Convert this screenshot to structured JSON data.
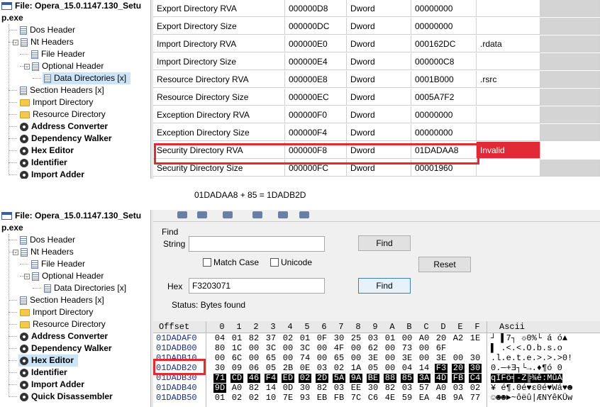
{
  "note": "01DADAA8 + 85 = 1DADB2D",
  "top_tree": [
    {
      "label": "File: Opera_15.0.1147.130_Setu",
      "icon": "window-icon",
      "bold": true,
      "indent": 0
    },
    {
      "label": "p.exe",
      "icon": "",
      "bold": true,
      "indent": 0
    },
    {
      "label": "Dos Header",
      "icon": "page-icon",
      "bold": false,
      "indent": 1
    },
    {
      "label": "Nt Headers",
      "icon": "page-icon",
      "bold": false,
      "indent": 1,
      "expander": "-"
    },
    {
      "label": "File Header",
      "icon": "page-icon",
      "bold": false,
      "indent": 2
    },
    {
      "label": "Optional Header",
      "icon": "page-icon",
      "bold": false,
      "indent": 2,
      "expander": "-"
    },
    {
      "label": "Data Directories [x]",
      "icon": "page-icon",
      "bold": false,
      "indent": 3,
      "selected": true
    },
    {
      "label": "Section Headers [x]",
      "icon": "page-icon",
      "bold": false,
      "indent": 1
    },
    {
      "label": "Import Directory",
      "icon": "folder-icon",
      "bold": false,
      "indent": 1
    },
    {
      "label": "Resource Directory",
      "icon": "folder-icon",
      "bold": false,
      "indent": 1
    },
    {
      "label": "Address Converter",
      "icon": "gear-icon",
      "bold": true,
      "indent": 1
    },
    {
      "label": "Dependency Walker",
      "icon": "gear-icon",
      "bold": true,
      "indent": 1
    },
    {
      "label": "Hex Editor",
      "icon": "gear-icon",
      "bold": true,
      "indent": 1
    },
    {
      "label": "Identifier",
      "icon": "gear-icon",
      "bold": true,
      "indent": 1
    },
    {
      "label": "Import Adder",
      "icon": "gear-icon",
      "bold": true,
      "indent": 1
    }
  ],
  "dir_rows": [
    {
      "member": "Export Directory RVA",
      "offset": "000000D8",
      "size": "Dword",
      "value": "00000000",
      "section": ""
    },
    {
      "member": "Export Directory Size",
      "offset": "000000DC",
      "size": "Dword",
      "value": "00000000",
      "section": ""
    },
    {
      "member": "Import Directory RVA",
      "offset": "000000E0",
      "size": "Dword",
      "value": "000162DC",
      "section": ".rdata"
    },
    {
      "member": "Import Directory Size",
      "offset": "000000E4",
      "size": "Dword",
      "value": "000000C8",
      "section": ""
    },
    {
      "member": "Resource Directory RVA",
      "offset": "000000E8",
      "size": "Dword",
      "value": "0001B000",
      "section": ".rsrc"
    },
    {
      "member": "Resource Directory Size",
      "offset": "000000EC",
      "size": "Dword",
      "value": "0005A7F2",
      "section": ""
    },
    {
      "member": "Exception Directory RVA",
      "offset": "000000F0",
      "size": "Dword",
      "value": "00000000",
      "section": ""
    },
    {
      "member": "Exception Directory Size",
      "offset": "000000F4",
      "size": "Dword",
      "value": "00000000",
      "section": ""
    },
    {
      "member": "Security Directory RVA",
      "offset": "000000F8",
      "size": "Dword",
      "value": "01DADAA8",
      "section": "Invalid"
    },
    {
      "member": "Security Directory Size",
      "offset": "000000FC",
      "size": "Dword",
      "value": "00001960",
      "section": ""
    }
  ],
  "bottom_tree": [
    {
      "label": "File: Opera_15.0.1147.130_Setu",
      "icon": "window-icon",
      "bold": true,
      "indent": 0
    },
    {
      "label": "p.exe",
      "icon": "",
      "bold": true,
      "indent": 0
    },
    {
      "label": "Dos Header",
      "icon": "page-icon",
      "bold": false,
      "indent": 1
    },
    {
      "label": "Nt Headers",
      "icon": "page-icon",
      "bold": false,
      "indent": 1,
      "expander": "-"
    },
    {
      "label": "File Header",
      "icon": "page-icon",
      "bold": false,
      "indent": 2
    },
    {
      "label": "Optional Header",
      "icon": "page-icon",
      "bold": false,
      "indent": 2,
      "expander": "-"
    },
    {
      "label": "Data Directories [x]",
      "icon": "page-icon",
      "bold": false,
      "indent": 3
    },
    {
      "label": "Section Headers [x]",
      "icon": "page-icon",
      "bold": false,
      "indent": 1
    },
    {
      "label": "Import Directory",
      "icon": "folder-icon",
      "bold": false,
      "indent": 1
    },
    {
      "label": "Resource Directory",
      "icon": "folder-icon",
      "bold": false,
      "indent": 1
    },
    {
      "label": "Address Converter",
      "icon": "gear-icon",
      "bold": true,
      "indent": 1
    },
    {
      "label": "Dependency Walker",
      "icon": "gear-icon",
      "bold": true,
      "indent": 1
    },
    {
      "label": "Hex Editor",
      "icon": "gear-icon",
      "bold": true,
      "indent": 1,
      "selected": true
    },
    {
      "label": "Identifier",
      "icon": "gear-icon",
      "bold": true,
      "indent": 1
    },
    {
      "label": "Import Adder",
      "icon": "gear-icon",
      "bold": true,
      "indent": 1
    },
    {
      "label": "Quick Disassembler",
      "icon": "gear-icon",
      "bold": true,
      "indent": 1
    }
  ],
  "find": {
    "group_label": "Find",
    "string_label": "String",
    "string_value": "",
    "find_string_button": "Find",
    "match_case_label": "Match Case",
    "unicode_label": "Unicode",
    "reset_button": "Reset",
    "hex_label": "Hex",
    "hex_value": "F3203071",
    "find_hex_button": "Find",
    "status": "Status: Bytes found"
  },
  "hex": {
    "offset_header": "Offset",
    "columns": [
      "0",
      "1",
      "2",
      "3",
      "4",
      "5",
      "6",
      "7",
      "8",
      "9",
      "A",
      "B",
      "C",
      "D",
      "E",
      "F"
    ],
    "ascii_header": "Ascii",
    "rows": [
      {
        "offset": "01DADAF0",
        "bytes": [
          "04",
          "01",
          "82",
          "37",
          "02",
          "01",
          "0F",
          "30",
          "25",
          "03",
          "01",
          "00",
          "A0",
          "20",
          "A2",
          "1E"
        ],
        "ascii": "┘ ▌7┐ ☼0%└   á ó▲",
        "hl": [],
        "ascii_hl": false
      },
      {
        "offset": "01DADB00",
        "bytes": [
          "80",
          "1C",
          "00",
          "3C",
          "00",
          "3C",
          "00",
          "4F",
          "00",
          "62",
          "00",
          "73",
          "00",
          "6F"
        ],
        "ascii": "▌ .<.<.O.b.s.o",
        "hl": [],
        "ascii_hl": false
      },
      {
        "offset": "01DADB10",
        "bytes": [
          "00",
          "6C",
          "00",
          "65",
          "00",
          "74",
          "00",
          "65",
          "00",
          "3E",
          "00",
          "3E",
          "00",
          "3E",
          "00",
          "30",
          "21"
        ],
        "ascii": ".l.e.t.e.>.>.>0!",
        "hl": [],
        "ascii_hl": false
      },
      {
        "offset": "01DADB20",
        "bytes": [
          "30",
          "09",
          "06",
          "05",
          "2B",
          "0E",
          "03",
          "02",
          "1A",
          "05",
          "00",
          "04",
          "14",
          "F3",
          "20",
          "30"
        ],
        "ascii": "0.─+Ǝ┐└→.♦¶ó 0",
        "hl": [
          13,
          14,
          15
        ],
        "ascii_hl": false
      },
      {
        "offset": "01DADB30",
        "bytes": [
          "71",
          "CD",
          "46",
          "F4",
          "ED",
          "02",
          "2D",
          "5A",
          "9A",
          "BE",
          "88",
          "85",
          "3A",
          "4D",
          "FB",
          "C4"
        ],
        "ascii": "qÍFö╡-Z╠¾ê:MûÄ",
        "hl": [
          0,
          1,
          2,
          3,
          4,
          5,
          6,
          7,
          8,
          9,
          10,
          11,
          12,
          13,
          14,
          15
        ],
        "ascii_hl": true
      },
      {
        "offset": "01DADB40",
        "bytes": [
          "9D",
          "A0",
          "82",
          "14",
          "0D",
          "30",
          "82",
          "03",
          "EE",
          "30",
          "82",
          "03",
          "57",
          "A0",
          "03",
          "02"
        ],
        "ascii": "¥ é¶.0é♥ε0é♥Wá♥☻",
        "hl": [
          0
        ],
        "ascii_hl": false
      },
      {
        "offset": "01DADB50",
        "bytes": [
          "01",
          "02",
          "02",
          "10",
          "7E",
          "93",
          "EB",
          "FB",
          "7C",
          "C6",
          "4E",
          "59",
          "EA",
          "4B",
          "9A",
          "77"
        ],
        "ascii": "☺☻☻►~ôëû|ÆNYêKÜw",
        "hl": [],
        "ascii_hl": false
      }
    ]
  }
}
